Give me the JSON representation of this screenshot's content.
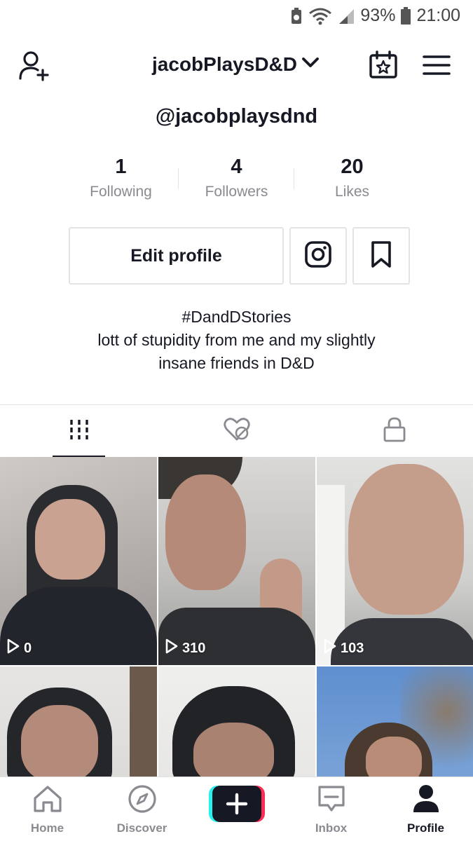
{
  "status": {
    "battery_percent": "93%",
    "time": "21:00"
  },
  "header": {
    "username": "jacobPlaysD&D"
  },
  "profile": {
    "handle": "@jacobplaysdnd",
    "stats": [
      {
        "value": "1",
        "label": "Following"
      },
      {
        "value": "4",
        "label": "Followers"
      },
      {
        "value": "20",
        "label": "Likes"
      }
    ],
    "edit_label": "Edit profile",
    "bio": [
      "#DandDStories",
      "lott of stupidity from me and my slightly",
      "insane friends in D&D"
    ]
  },
  "tabs": {
    "icons": [
      "grid-icon",
      "liked-hidden-icon",
      "lock-icon"
    ],
    "active": 0
  },
  "videos": [
    {
      "views": "0"
    },
    {
      "views": "310"
    },
    {
      "views": "103"
    },
    {
      "views": ""
    },
    {
      "views": ""
    },
    {
      "views": ""
    }
  ],
  "nav": {
    "items": [
      {
        "label": "Home",
        "icon": "home-icon"
      },
      {
        "label": "Discover",
        "icon": "compass-icon"
      },
      {
        "label": "",
        "icon": "plus-icon"
      },
      {
        "label": "Inbox",
        "icon": "inbox-icon"
      },
      {
        "label": "Profile",
        "icon": "profile-icon"
      }
    ],
    "active": "Profile"
  },
  "colors": {
    "text": "#161823",
    "muted": "#8a8b91",
    "border": "#e3e3e4",
    "cyan": "#25f4ee",
    "pink": "#fe2c55"
  }
}
